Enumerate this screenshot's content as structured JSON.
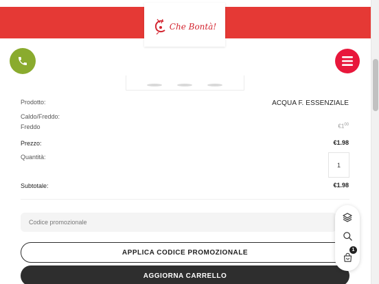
{
  "brand": {
    "logo_text": "Che Bontà!",
    "header_color": "#e53935",
    "phone_color": "#8aab2e",
    "menu_color": "#e8173b"
  },
  "icons": {
    "phone": "phone-icon",
    "menu": "hamburger-menu-icon",
    "layers": "layers-icon",
    "search": "search-icon",
    "cart": "cart-icon"
  },
  "cart": {
    "product_label": "Prodotto:",
    "product_value": "ACQUA F. ESSENZIALE",
    "option_label_line1": "Caldo/Freddo:",
    "option_label_line2": "Freddo",
    "option_price_main": "€1",
    "option_price_sup": "00",
    "price_label": "Prezzo:",
    "price_value": "€1.98",
    "quantity_label": "Quantità:",
    "quantity_value": "1",
    "subtotal_label": "Subtotale:",
    "subtotal_value": "€1.98"
  },
  "promo": {
    "placeholder": "Codice promozionale",
    "apply_label": "APPLICA CODICE PROMOZIONALE",
    "update_label": "AGGIORNA CARRELLO"
  },
  "toolbar": {
    "cart_count": "1"
  }
}
